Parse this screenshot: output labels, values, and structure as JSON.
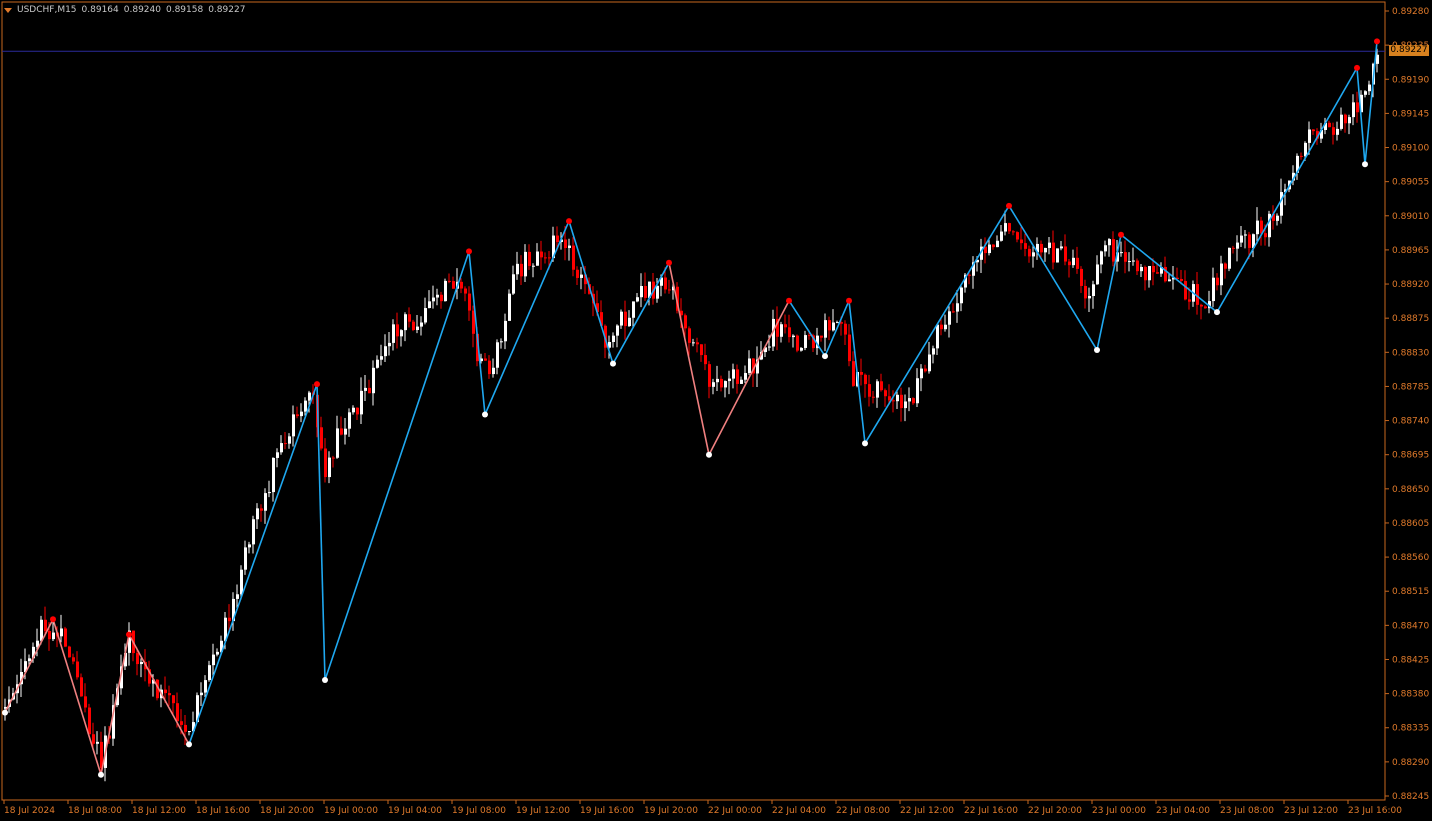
{
  "header": {
    "symbol": "USDCHF,M15",
    "open": "0.89164",
    "high": "0.89240",
    "low": "0.89158",
    "close": "0.89227"
  },
  "current_price": {
    "label": "0.89227",
    "value": 0.89227
  },
  "colors": {
    "background": "#000000",
    "frame": "#c8671e",
    "axis_text": "#e07a2b",
    "bull_candle": "#ffffff",
    "bear_candle": "#ff0000",
    "zigzag_up": "#1fa8f0",
    "zigzag_down": "#f08080",
    "pivot_high": "#ff0000",
    "pivot_low": "#ffffff",
    "price_line": "#2a2a9a"
  },
  "chart_data": {
    "type": "candlestick",
    "symbol": "USDCHF",
    "timeframe": "M15",
    "ylim": [
      0.88245,
      0.8928
    ],
    "y_ticks": [
      "0.89280",
      "0.89235",
      "0.89190",
      "0.89145",
      "0.89100",
      "0.89055",
      "0.89010",
      "0.88965",
      "0.88920",
      "0.88875",
      "0.88830",
      "0.88785",
      "0.88740",
      "0.88695",
      "0.88650",
      "0.88605",
      "0.88560",
      "0.88515",
      "0.88470",
      "0.88425",
      "0.88380",
      "0.88335",
      "0.88290",
      "0.88245"
    ],
    "x_ticks": [
      "18 Jul 2024",
      "18 Jul 08:00",
      "18 Jul 12:00",
      "18 Jul 16:00",
      "18 Jul 20:00",
      "19 Jul 00:00",
      "19 Jul 04:00",
      "19 Jul 08:00",
      "19 Jul 12:00",
      "19 Jul 16:00",
      "19 Jul 20:00",
      "22 Jul 00:00",
      "22 Jul 04:00",
      "22 Jul 08:00",
      "22 Jul 12:00",
      "22 Jul 16:00",
      "22 Jul 20:00",
      "23 Jul 00:00",
      "23 Jul 04:00",
      "23 Jul 08:00",
      "23 Jul 12:00",
      "23 Jul 16:00"
    ],
    "x_tick_index": [
      0,
      16,
      32,
      48,
      64,
      80,
      96,
      112,
      128,
      144,
      160,
      176,
      192,
      208,
      224,
      240,
      256,
      272,
      288,
      304,
      320,
      336
    ],
    "bar_count": 344,
    "candle_path": [
      {
        "i": 0,
        "p": 0.8836
      },
      {
        "i": 8,
        "p": 0.8846
      },
      {
        "i": 12,
        "p": 0.8847
      },
      {
        "i": 14,
        "p": 0.8846
      },
      {
        "i": 24,
        "p": 0.8829
      },
      {
        "i": 31,
        "p": 0.8845
      },
      {
        "i": 38,
        "p": 0.8838
      },
      {
        "i": 46,
        "p": 0.8834
      },
      {
        "i": 50,
        "p": 0.884
      },
      {
        "i": 56,
        "p": 0.8848
      },
      {
        "i": 62,
        "p": 0.886
      },
      {
        "i": 70,
        "p": 0.8872
      },
      {
        "i": 77,
        "p": 0.8877
      },
      {
        "i": 80,
        "p": 0.8868
      },
      {
        "i": 84,
        "p": 0.8873
      },
      {
        "i": 90,
        "p": 0.8878
      },
      {
        "i": 96,
        "p": 0.8885
      },
      {
        "i": 104,
        "p": 0.8888
      },
      {
        "i": 114,
        "p": 0.8893
      },
      {
        "i": 118,
        "p": 0.8882
      },
      {
        "i": 122,
        "p": 0.8881
      },
      {
        "i": 128,
        "p": 0.8894
      },
      {
        "i": 140,
        "p": 0.8898
      },
      {
        "i": 150,
        "p": 0.8884
      },
      {
        "i": 160,
        "p": 0.8891
      },
      {
        "i": 166,
        "p": 0.8892
      },
      {
        "i": 175,
        "p": 0.888
      },
      {
        "i": 184,
        "p": 0.8879
      },
      {
        "i": 192,
        "p": 0.8886
      },
      {
        "i": 200,
        "p": 0.8884
      },
      {
        "i": 208,
        "p": 0.8888
      },
      {
        "i": 212,
        "p": 0.888
      },
      {
        "i": 216,
        "p": 0.8878
      },
      {
        "i": 226,
        "p": 0.8876
      },
      {
        "i": 232,
        "p": 0.8884
      },
      {
        "i": 240,
        "p": 0.8893
      },
      {
        "i": 250,
        "p": 0.89
      },
      {
        "i": 256,
        "p": 0.8897
      },
      {
        "i": 266,
        "p": 0.8896
      },
      {
        "i": 270,
        "p": 0.889
      },
      {
        "i": 274,
        "p": 0.8897
      },
      {
        "i": 284,
        "p": 0.8894
      },
      {
        "i": 300,
        "p": 0.889
      },
      {
        "i": 306,
        "p": 0.8896
      },
      {
        "i": 316,
        "p": 0.89
      },
      {
        "i": 326,
        "p": 0.8911
      },
      {
        "i": 334,
        "p": 0.8914
      },
      {
        "i": 339,
        "p": 0.8916
      },
      {
        "i": 343,
        "p": 0.8922
      }
    ],
    "zigzag": [
      {
        "i": 0,
        "p": 0.88355,
        "t": "L"
      },
      {
        "i": 12,
        "p": 0.88478,
        "t": "H"
      },
      {
        "i": 24,
        "p": 0.88273,
        "t": "L"
      },
      {
        "i": 31,
        "p": 0.88458,
        "t": "H"
      },
      {
        "i": 46,
        "p": 0.88313,
        "t": "L"
      },
      {
        "i": 78,
        "p": 0.88788,
        "t": "H"
      },
      {
        "i": 80,
        "p": 0.88398,
        "t": "L"
      },
      {
        "i": 116,
        "p": 0.88963,
        "t": "H"
      },
      {
        "i": 120,
        "p": 0.88748,
        "t": "L"
      },
      {
        "i": 141,
        "p": 0.89003,
        "t": "H"
      },
      {
        "i": 152,
        "p": 0.88815,
        "t": "L"
      },
      {
        "i": 166,
        "p": 0.88948,
        "t": "H"
      },
      {
        "i": 176,
        "p": 0.88695,
        "t": "L"
      },
      {
        "i": 196,
        "p": 0.88898,
        "t": "H"
      },
      {
        "i": 205,
        "p": 0.88825,
        "t": "L"
      },
      {
        "i": 211,
        "p": 0.88898,
        "t": "H"
      },
      {
        "i": 215,
        "p": 0.8871,
        "t": "L"
      },
      {
        "i": 251,
        "p": 0.89023,
        "t": "H"
      },
      {
        "i": 273,
        "p": 0.88833,
        "t": "L"
      },
      {
        "i": 279,
        "p": 0.88985,
        "t": "H"
      },
      {
        "i": 303,
        "p": 0.88883,
        "t": "L"
      },
      {
        "i": 338,
        "p": 0.89205,
        "t": "H"
      },
      {
        "i": 340,
        "p": 0.89078,
        "t": "L"
      },
      {
        "i": 343,
        "p": 0.8924,
        "t": "H"
      }
    ]
  }
}
